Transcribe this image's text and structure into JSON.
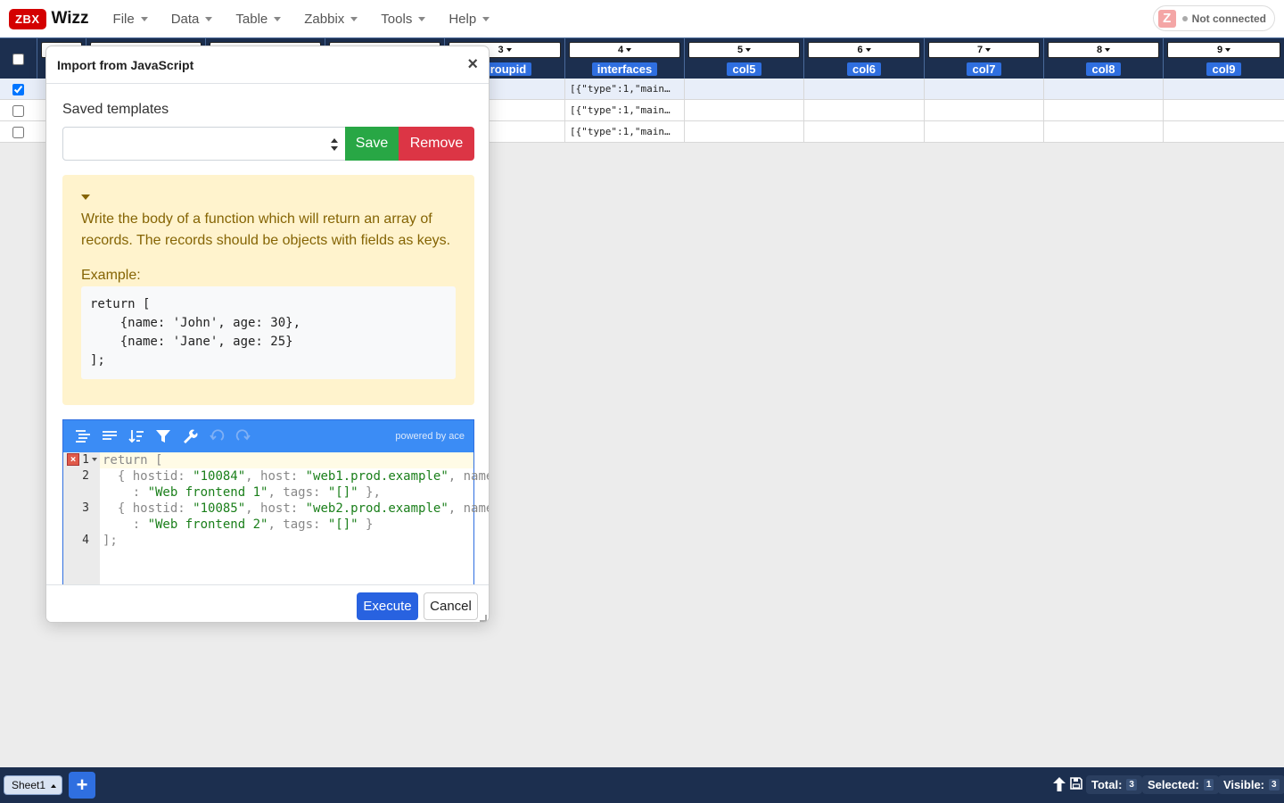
{
  "app": {
    "badge": "ZBX",
    "name": "Wizz"
  },
  "menu": [
    "File",
    "Data",
    "Table",
    "Zabbix",
    "Tools",
    "Help"
  ],
  "connection": {
    "icon_letter": "Z",
    "status": "Not connected"
  },
  "table": {
    "columns": [
      {
        "num": "3",
        "name": "groupid"
      },
      {
        "num": "4",
        "name": "interfaces"
      },
      {
        "num": "5",
        "name": "col5"
      },
      {
        "num": "6",
        "name": "col6"
      },
      {
        "num": "7",
        "name": "col7"
      },
      {
        "num": "8",
        "name": "col8"
      },
      {
        "num": "9",
        "name": "col9"
      }
    ],
    "rows": [
      {
        "selected": true,
        "interfaces": "[{\"type\":1,\"main…"
      },
      {
        "selected": false,
        "interfaces": "[{\"type\":1,\"main…"
      },
      {
        "selected": false,
        "interfaces": "[{\"type\":1,\"main…"
      }
    ]
  },
  "modal": {
    "title": "Import from JavaScript",
    "close": "×",
    "saved_label": "Saved templates",
    "save": "Save",
    "remove": "Remove",
    "info_text": "Write the body of a function which will return an array of records. The records should be objects with fields as keys.",
    "example_label": "Example:",
    "example_code": "return [\n    {name: 'John', age: 30},\n    {name: 'Jane', age: 25}\n];",
    "editor": {
      "powered": "powered by ace",
      "line_numbers": [
        "1",
        "2",
        "3",
        "4"
      ],
      "error_mark": "×"
    },
    "execute": "Execute",
    "cancel": "Cancel"
  },
  "footer": {
    "sheet": "Sheet1",
    "add": "+",
    "total_label": "Total:",
    "total": "3",
    "selected_label": "Selected:",
    "selected": "1",
    "visible_label": "Visible:",
    "visible": "3"
  }
}
